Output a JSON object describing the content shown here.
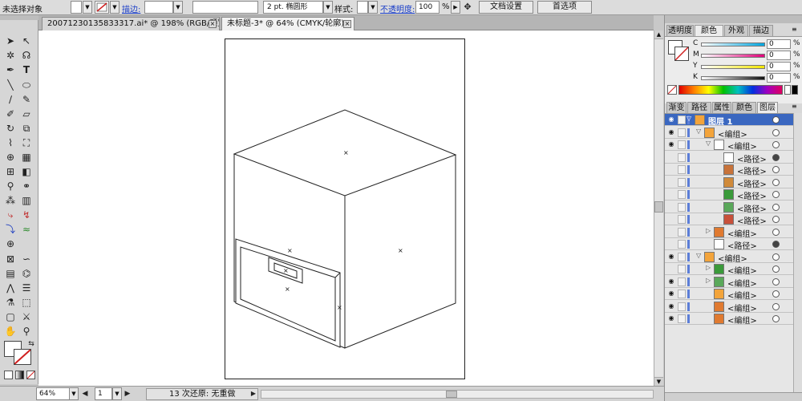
{
  "control_bar": {
    "selection_status": "未选择对象",
    "stroke_link": "描边:",
    "stroke_weight_unit": "2 pt. 椭圆形",
    "style_label": "样式:",
    "opacity_link": "不透明度:",
    "opacity_value": "100",
    "opacity_unit": "%",
    "doc_setup_button": "文档设置",
    "prefs_button": "首选项"
  },
  "doc_tabs": [
    {
      "label": "20071230135833317.ai* @ 198% (RGB/预览)",
      "active": false
    },
    {
      "label": "未标题-3* @ 64% (CMYK/轮廓)",
      "active": true
    }
  ],
  "status_bar": {
    "zoom": "64%",
    "page": "1",
    "undo_info": "13 次还原: 无重做"
  },
  "color_panel": {
    "tabs": [
      "透明度",
      "颜色",
      "外观",
      "描边"
    ],
    "channels": [
      {
        "label": "C",
        "value": "0",
        "unit": "%"
      },
      {
        "label": "M",
        "value": "0",
        "unit": "%"
      },
      {
        "label": "Y",
        "value": "0",
        "unit": "%"
      },
      {
        "label": "K",
        "value": "0",
        "unit": "%"
      }
    ]
  },
  "layers_panel": {
    "tabs": [
      "渐变",
      "路径查",
      "属性",
      "颜色参",
      "图层"
    ],
    "rows": [
      {
        "name": "图层 1",
        "level": 0,
        "twisty": "▽",
        "eye": true,
        "selected": true,
        "target": "ring",
        "thumb_color": "#f3a43b"
      },
      {
        "name": "<编组>",
        "level": 1,
        "twisty": "▽",
        "eye": true,
        "selected": false,
        "target": "ring",
        "thumb_color": "#f3a43b"
      },
      {
        "name": "<编组>",
        "level": 2,
        "twisty": "▽",
        "eye": true,
        "selected": false,
        "target": "ring",
        "thumb_color": "#ffffff"
      },
      {
        "name": "<路径>",
        "level": 3,
        "twisty": "",
        "eye": false,
        "selected": false,
        "target": "fill",
        "thumb_color": "#ffffff"
      },
      {
        "name": "<路径>",
        "level": 3,
        "twisty": "",
        "eye": false,
        "selected": false,
        "target": "ring",
        "thumb_color": "#c8733a"
      },
      {
        "name": "<路径>",
        "level": 3,
        "twisty": "",
        "eye": false,
        "selected": false,
        "target": "ring",
        "thumb_color": "#d08a3a"
      },
      {
        "name": "<路径>",
        "level": 3,
        "twisty": "",
        "eye": false,
        "selected": false,
        "target": "ring",
        "thumb_color": "#3a9a3a"
      },
      {
        "name": "<路径>",
        "level": 3,
        "twisty": "",
        "eye": false,
        "selected": false,
        "target": "ring",
        "thumb_color": "#5aa85a"
      },
      {
        "name": "<路径>",
        "level": 3,
        "twisty": "",
        "eye": false,
        "selected": false,
        "target": "ring",
        "thumb_color": "#c8503a"
      },
      {
        "name": "<编组>",
        "level": 2,
        "twisty": "▷",
        "eye": false,
        "selected": false,
        "target": "ring",
        "thumb_color": "#e07a30"
      },
      {
        "name": "<路径>",
        "level": 2,
        "twisty": "",
        "eye": false,
        "selected": false,
        "target": "fill",
        "thumb_color": "#ffffff"
      },
      {
        "name": "<编组>",
        "level": 1,
        "twisty": "▽",
        "eye": true,
        "selected": false,
        "target": "ring",
        "thumb_color": "#f3a43b"
      },
      {
        "name": "<编组>",
        "level": 2,
        "twisty": "▷",
        "eye": false,
        "selected": false,
        "target": "ring",
        "thumb_color": "#3a9a3a"
      },
      {
        "name": "<编组>",
        "level": 2,
        "twisty": "▷",
        "eye": true,
        "selected": false,
        "target": "ring",
        "thumb_color": "#5aa85a"
      },
      {
        "name": "<编组>",
        "level": 2,
        "twisty": "",
        "eye": true,
        "selected": false,
        "target": "ring",
        "thumb_color": "#f3a43b"
      },
      {
        "name": "<编组>",
        "level": 2,
        "twisty": "",
        "eye": true,
        "selected": false,
        "target": "ring",
        "thumb_color": "#e07a30"
      },
      {
        "name": "<编组>",
        "level": 2,
        "twisty": "",
        "eye": true,
        "selected": false,
        "target": "ring",
        "thumb_color": "#e07a30"
      }
    ]
  },
  "colors": {
    "selection_blue": "#3a67c0",
    "layer_color": "#5c7ed8"
  }
}
